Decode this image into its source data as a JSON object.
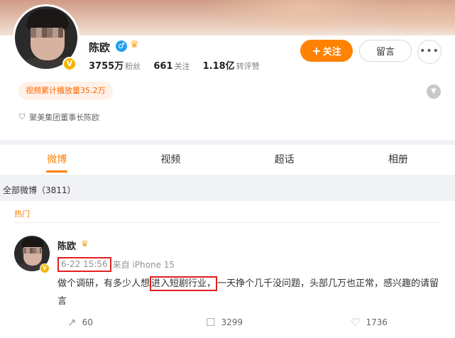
{
  "profile": {
    "name": "陈欧",
    "stats": [
      {
        "value": "3755万",
        "label": "粉丝"
      },
      {
        "value": "661",
        "label": "关注"
      },
      {
        "value": "1.18亿",
        "label": "转评赞"
      }
    ],
    "follow_label": "关注",
    "message_label": "留言",
    "more_label": "•••",
    "play_badge": "视频累计播放量35.2万",
    "bio": "聚美集团董事长陈欧"
  },
  "tabs": [
    {
      "label": "微博",
      "active": true
    },
    {
      "label": "视频",
      "active": false
    },
    {
      "label": "超话",
      "active": false
    },
    {
      "label": "相册",
      "active": false
    }
  ],
  "feed": {
    "section_title": "全部微博（3811）",
    "post": {
      "hot_label": "热门",
      "author": "陈欧",
      "time": "6-22 15:56",
      "source": "来自 iPhone 15",
      "text_before": "做个调研，有多少人想",
      "text_highlight": "进入短剧行业，",
      "text_after": "一天挣个几千没问题，头部几万也正常，感兴趣的请留言",
      "reposts": "60",
      "comments": "3299",
      "likes": "1736"
    }
  },
  "icons": {
    "gender": "male-icon",
    "crown": "crown-icon",
    "verified": "verified-v-icon",
    "shield": "shield-icon",
    "repost": "repost-icon",
    "comment": "comment-icon",
    "like": "like-icon"
  },
  "colors": {
    "accent": "#ff8200",
    "highlight_box": "#e02020",
    "verified": "#f7b500",
    "gender": "#1da1f2"
  }
}
